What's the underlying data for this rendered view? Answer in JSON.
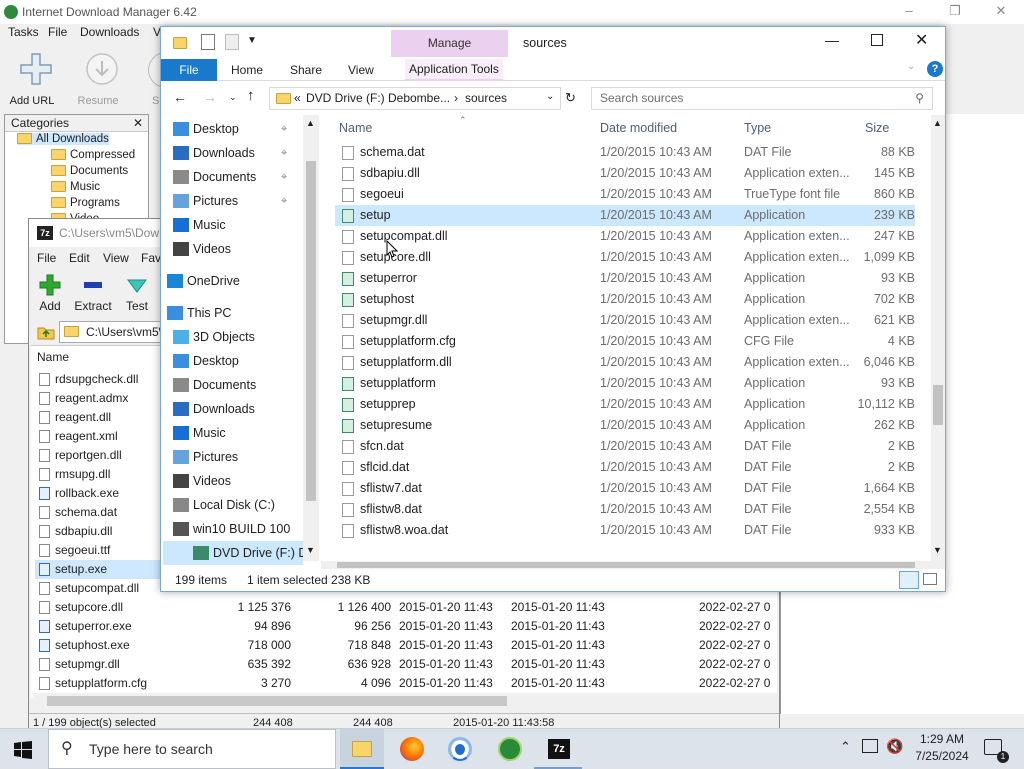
{
  "idm": {
    "title": "Internet Download Manager 6.42",
    "menu": [
      "Tasks",
      "File",
      "Downloads",
      "V"
    ],
    "toolbar": {
      "add_url": "Add URL",
      "resume": "Resume",
      "partial": "S"
    },
    "categories": {
      "header": "Categories",
      "items": [
        "All Downloads",
        "Compressed",
        "Documents",
        "Music",
        "Programs",
        "Video"
      ]
    }
  },
  "zip": {
    "title": "C:\\Users\\vm5\\Dow",
    "menu": [
      "File",
      "Edit",
      "View",
      "Fav"
    ],
    "toolbar": [
      "Add",
      "Extract",
      "Test"
    ],
    "address": "C:\\Users\\vm5\\",
    "column_name": "Name",
    "files": [
      {
        "name": "rdsupgcheck.dll"
      },
      {
        "name": "reagent.admx"
      },
      {
        "name": "reagent.dll"
      },
      {
        "name": "reagent.xml"
      },
      {
        "name": "reportgen.dll"
      },
      {
        "name": "rmsupg.dll"
      },
      {
        "name": "rollback.exe"
      },
      {
        "name": "schema.dat"
      },
      {
        "name": "sdbapiu.dll"
      },
      {
        "name": "segoeui.ttf"
      },
      {
        "name": "setup.exe"
      },
      {
        "name": "setupcompat.dll"
      },
      {
        "name": "setupcore.dll",
        "size": "1 125 376",
        "packed": "1 126 400",
        "modified": "2015-01-20 11:43",
        "created": "2015-01-20 11:43",
        "accessed": "2022-02-27 0"
      },
      {
        "name": "setuperror.exe",
        "size": "94 896",
        "packed": "96 256",
        "modified": "2015-01-20 11:43",
        "created": "2015-01-20 11:43",
        "accessed": "2022-02-27 0"
      },
      {
        "name": "setuphost.exe",
        "size": "718 000",
        "packed": "718 848",
        "modified": "2015-01-20 11:43",
        "created": "2015-01-20 11:43",
        "accessed": "2022-02-27 0"
      },
      {
        "name": "setupmgr.dll",
        "size": "635 392",
        "packed": "636 928",
        "modified": "2015-01-20 11:43",
        "created": "2015-01-20 11:43",
        "accessed": "2022-02-27 0"
      },
      {
        "name": "setupplatform.cfg",
        "size": "3 270",
        "packed": "4 096",
        "modified": "2015-01-20 11:43",
        "created": "2015-01-20 11:43",
        "accessed": "2022-02-27 0"
      }
    ],
    "status": {
      "selection": "1 / 199 object(s) selected",
      "size": "244 408",
      "packed": "244 408",
      "modified": "2015-01-20 11:43:58"
    }
  },
  "explorer": {
    "title": "sources",
    "manage": "Manage",
    "tabs": {
      "file": "File",
      "home": "Home",
      "share": "Share",
      "view": "View",
      "app_tools": "Application Tools"
    },
    "breadcrumb": {
      "prefix": "«",
      "drive": "DVD Drive (F:) Debombe...",
      "sep": "›",
      "folder": "sources"
    },
    "search_placeholder": "Search sources",
    "nav": [
      {
        "label": "Desktop",
        "pinned": true
      },
      {
        "label": "Downloads",
        "pinned": true
      },
      {
        "label": "Documents",
        "pinned": true
      },
      {
        "label": "Pictures",
        "pinned": true
      },
      {
        "label": "Music"
      },
      {
        "label": "Videos"
      },
      {
        "label": "OneDrive"
      },
      {
        "label": "This PC"
      },
      {
        "label": "3D Objects"
      },
      {
        "label": "Desktop"
      },
      {
        "label": "Documents"
      },
      {
        "label": "Downloads"
      },
      {
        "label": "Music"
      },
      {
        "label": "Pictures"
      },
      {
        "label": "Videos"
      },
      {
        "label": "Local Disk (C:)"
      },
      {
        "label": "win10 BUILD 100"
      },
      {
        "label": "DVD Drive (F:) D"
      }
    ],
    "columns": {
      "name": "Name",
      "date": "Date modified",
      "type": "Type",
      "size": "Size"
    },
    "files": [
      {
        "name": "schema.dat",
        "date": "1/20/2015 10:43 AM",
        "type": "DAT File",
        "size": "88 KB"
      },
      {
        "name": "sdbapiu.dll",
        "date": "1/20/2015 10:43 AM",
        "type": "Application exten...",
        "size": "145 KB"
      },
      {
        "name": "segoeui",
        "date": "1/20/2015 10:43 AM",
        "type": "TrueType font file",
        "size": "860 KB"
      },
      {
        "name": "setup",
        "date": "1/20/2015 10:43 AM",
        "type": "Application",
        "size": "239 KB"
      },
      {
        "name": "setupcompat.dll",
        "date": "1/20/2015 10:43 AM",
        "type": "Application exten...",
        "size": "247 KB"
      },
      {
        "name": "setupcore.dll",
        "date": "1/20/2015 10:43 AM",
        "type": "Application exten...",
        "size": "1,099 KB"
      },
      {
        "name": "setuperror",
        "date": "1/20/2015 10:43 AM",
        "type": "Application",
        "size": "93 KB"
      },
      {
        "name": "setuphost",
        "date": "1/20/2015 10:43 AM",
        "type": "Application",
        "size": "702 KB"
      },
      {
        "name": "setupmgr.dll",
        "date": "1/20/2015 10:43 AM",
        "type": "Application exten...",
        "size": "621 KB"
      },
      {
        "name": "setupplatform.cfg",
        "date": "1/20/2015 10:43 AM",
        "type": "CFG File",
        "size": "4 KB"
      },
      {
        "name": "setupplatform.dll",
        "date": "1/20/2015 10:43 AM",
        "type": "Application exten...",
        "size": "6,046 KB"
      },
      {
        "name": "setupplatform",
        "date": "1/20/2015 10:43 AM",
        "type": "Application",
        "size": "93 KB"
      },
      {
        "name": "setupprep",
        "date": "1/20/2015 10:43 AM",
        "type": "Application",
        "size": "10,112 KB"
      },
      {
        "name": "setupresume",
        "date": "1/20/2015 10:43 AM",
        "type": "Application",
        "size": "262 KB"
      },
      {
        "name": "sfcn.dat",
        "date": "1/20/2015 10:43 AM",
        "type": "DAT File",
        "size": "2 KB"
      },
      {
        "name": "sflcid.dat",
        "date": "1/20/2015 10:43 AM",
        "type": "DAT File",
        "size": "2 KB"
      },
      {
        "name": "sflistw7.dat",
        "date": "1/20/2015 10:43 AM",
        "type": "DAT File",
        "size": "1,664 KB"
      },
      {
        "name": "sflistw8.dat",
        "date": "1/20/2015 10:43 AM",
        "type": "DAT File",
        "size": "2,554 KB"
      },
      {
        "name": "sflistw8.woa.dat",
        "date": "1/20/2015 10:43 AM",
        "type": "DAT File",
        "size": "933 KB"
      }
    ],
    "status": {
      "count": "199 items",
      "selected": "1 item selected  238 KB"
    }
  },
  "taskbar": {
    "search_placeholder": "Type here to search",
    "time": "1:29 AM",
    "date": "7/25/2024",
    "apps": [
      "file-explorer",
      "firefox",
      "chrome",
      "idm",
      "7zip"
    ]
  }
}
